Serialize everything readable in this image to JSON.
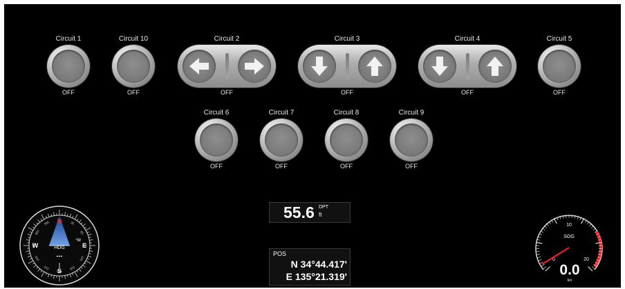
{
  "circuits_row1": [
    {
      "id": "circuit-1",
      "label": "Circuit 1",
      "state": "OFF",
      "kind": "round"
    },
    {
      "id": "circuit-10",
      "label": "Circuit 10",
      "state": "OFF",
      "kind": "round"
    },
    {
      "id": "circuit-2",
      "label": "Circuit 2",
      "state": "OFF",
      "kind": "pill",
      "icons": [
        "arrow-left-icon",
        "arrow-right-icon"
      ]
    },
    {
      "id": "circuit-3",
      "label": "Circuit 3",
      "state": "OFF",
      "kind": "pill",
      "icons": [
        "arrow-down-icon",
        "arrow-up-icon"
      ]
    },
    {
      "id": "circuit-4",
      "label": "Circuit 4",
      "state": "OFF",
      "kind": "pill",
      "icons": [
        "arrow-down-icon",
        "arrow-up-icon"
      ]
    },
    {
      "id": "circuit-5",
      "label": "Circuit 5",
      "state": "OFF",
      "kind": "round"
    }
  ],
  "circuits_row2": [
    {
      "id": "circuit-6",
      "label": "Circuit 6",
      "state": "OFF"
    },
    {
      "id": "circuit-7",
      "label": "Circuit 7",
      "state": "OFF"
    },
    {
      "id": "circuit-8",
      "label": "Circuit 8",
      "state": "OFF"
    },
    {
      "id": "circuit-9",
      "label": "Circuit 9",
      "state": "OFF"
    }
  ],
  "depth": {
    "value": "55.6",
    "label": "DPT",
    "unit": "ft"
  },
  "position": {
    "label": "POS",
    "lat": "N 34°44.417'",
    "lon": "E 135°21.319'"
  },
  "compass": {
    "label": "HDG",
    "value": "---",
    "cardinals": {
      "n": "N",
      "s": "S",
      "e": "E",
      "w": "W"
    },
    "mode": "°M",
    "degree_labels": [
      "0",
      "30",
      "60",
      "90",
      "120",
      "150",
      "180",
      "210",
      "240",
      "270",
      "300",
      "330"
    ],
    "accent_color": "#2b6fd6",
    "north_color": "#ff3030"
  },
  "speed": {
    "label": "SOG",
    "value": "0.0",
    "unit": "kn",
    "scale_labels": [
      "0",
      "10",
      "20"
    ],
    "redline_color": "#ff2020",
    "needle_color": "#ff2020"
  },
  "colors": {
    "background": "#000000",
    "text": "#ffffff"
  }
}
